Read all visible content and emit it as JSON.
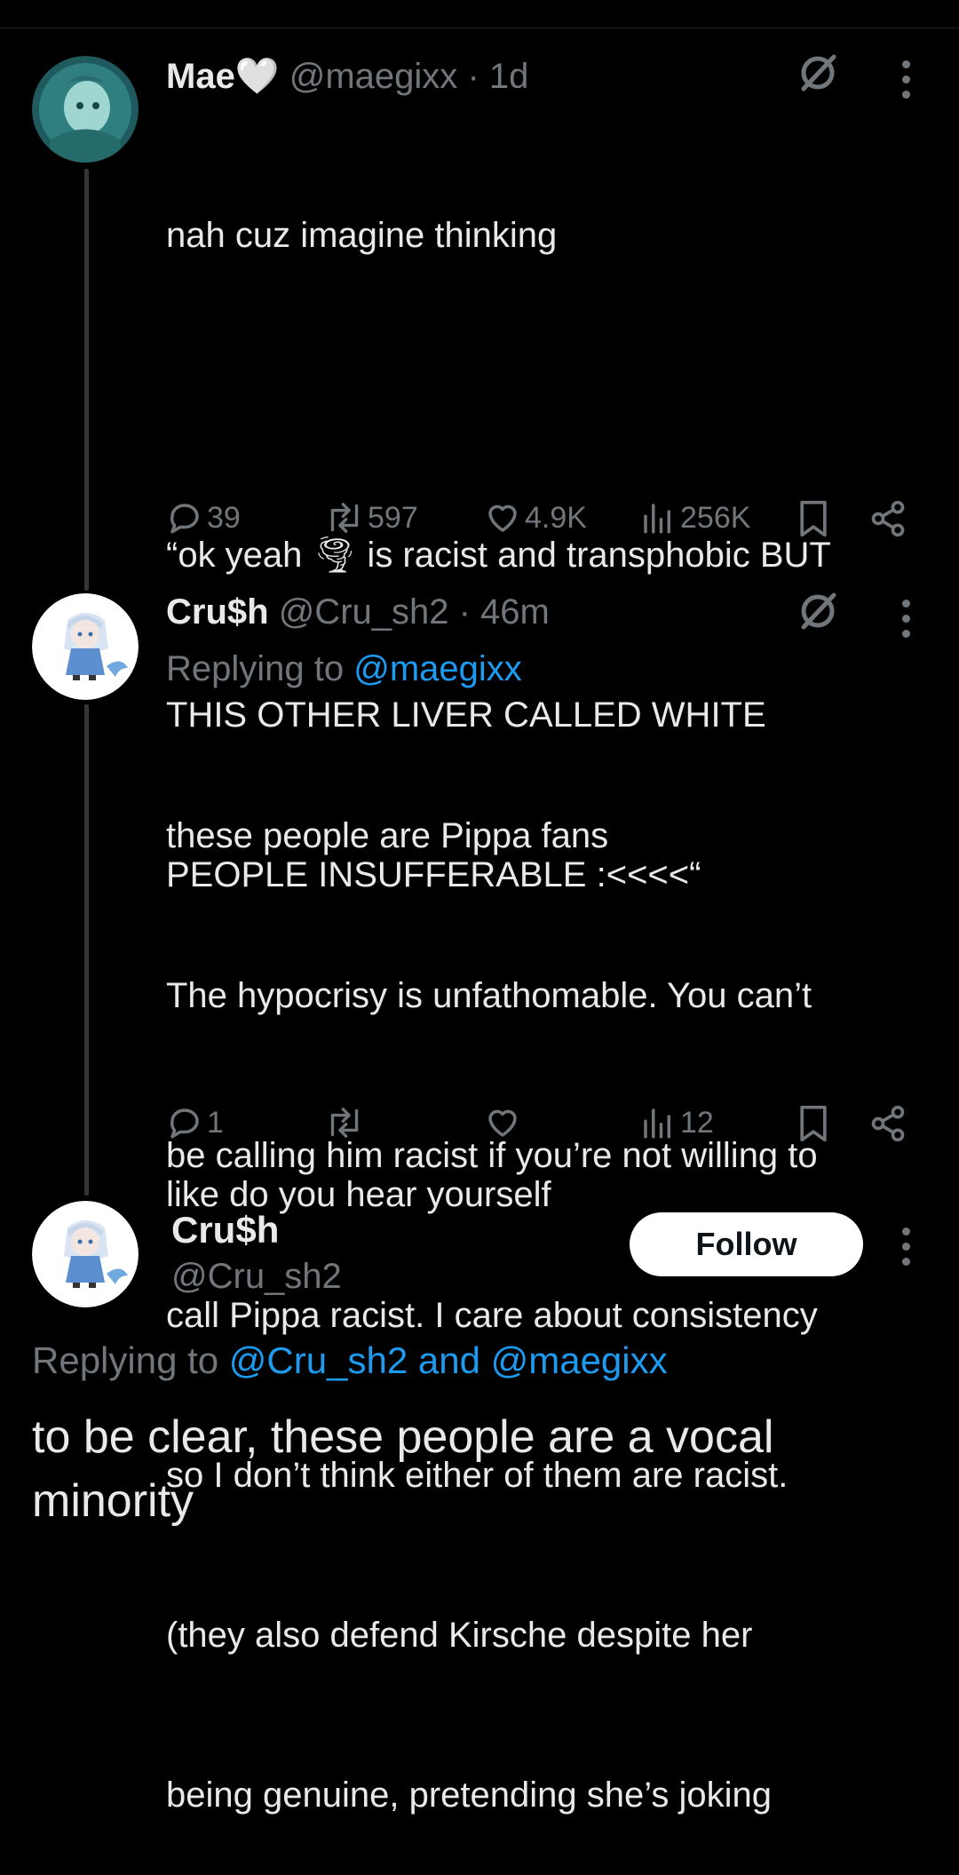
{
  "tweets": [
    {
      "display_name": "Mae",
      "name_emoji": "🤍",
      "handle": "@maegixx",
      "time": "· 1d",
      "lines": [
        "nah cuz imagine thinking",
        "",
        "“ok yeah 🌪 is racist and transphobic BUT",
        "THIS OTHER LIVER CALLED WHITE",
        "PEOPLE INSUFFERABLE :<<<<“",
        "",
        "like do you hear yourself"
      ],
      "stats": {
        "replies": "39",
        "reposts": "597",
        "likes": "4.9K",
        "views": "256K"
      }
    },
    {
      "display_name": "Cru$h",
      "handle": "@Cru_sh2",
      "time": "· 46m",
      "replying_prefix": "Replying to ",
      "replying_to": "@maegixx",
      "lines": [
        "these people are Pippa fans",
        "The hypocrisy is unfathomable. You can’t",
        "be calling him racist if you’re not willing to",
        "call Pippa racist. I care about consistency",
        "so I don’t think either of them are racist.",
        "(they also defend Kirsche despite her",
        "being genuine, pretending she’s joking"
      ],
      "stats": {
        "replies": "1",
        "reposts": "",
        "likes": "",
        "views": "12"
      }
    }
  ],
  "focused": {
    "display_name": "Cru$h",
    "handle": "@Cru_sh2",
    "follow_label": "Follow",
    "replying_prefix": "Replying to ",
    "replying_to": "@Cru_sh2 and @maegixx",
    "text_lines": [
      "to be clear, these people are a vocal",
      "minority"
    ]
  },
  "icons": [
    "no-entry-icon",
    "more-icon",
    "reply-icon",
    "repost-icon",
    "like-icon",
    "views-icon",
    "bookmark-icon",
    "share-icon"
  ],
  "colors": {
    "background": "#000000",
    "text": "#e7e9ea",
    "muted": "#71767b",
    "link": "#1d9bf0"
  }
}
